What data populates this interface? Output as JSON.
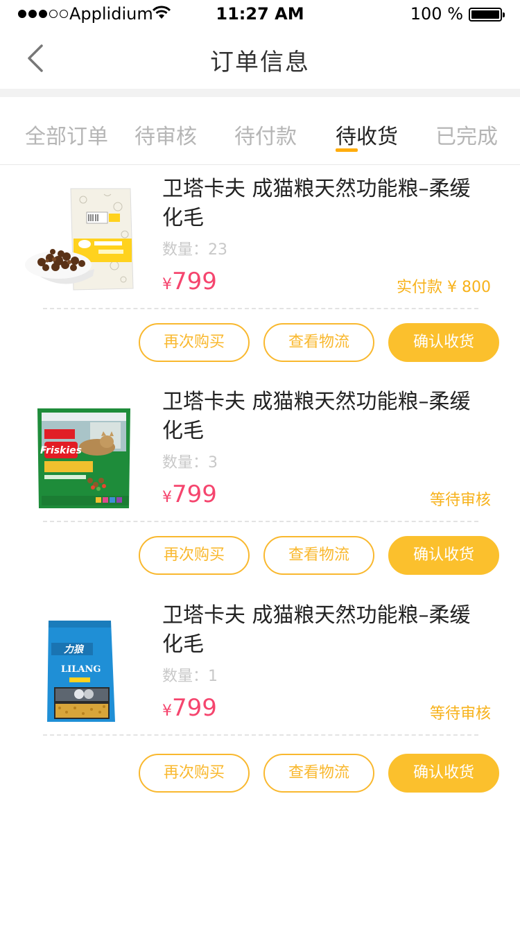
{
  "status_bar": {
    "carrier": "Applidium",
    "time": "11:27 AM",
    "battery": "100 %"
  },
  "nav": {
    "title": "订单信息",
    "back_icon": "chevron-left-icon"
  },
  "tabs": [
    {
      "label": "全部订单",
      "active": false
    },
    {
      "label": "待审核",
      "active": false
    },
    {
      "label": "待付款",
      "active": false
    },
    {
      "label": "待收货",
      "active": true
    },
    {
      "label": "已完成",
      "active": false
    }
  ],
  "orders": [
    {
      "title": "卫塔卡夫 成猫粮天然功能粮–柔缓化毛",
      "quantity": "数量：23",
      "price_symbol": "¥",
      "price": "799",
      "status": "实付款 ¥ 800",
      "buttons": [
        "再次购买",
        "查看物流",
        "确认收货"
      ]
    },
    {
      "title": "卫塔卡夫 成猫粮天然功能粮–柔缓化毛",
      "quantity": "数量：3",
      "price_symbol": "¥",
      "price": "799",
      "status": "等待审核",
      "buttons": [
        "再次购买",
        "查看物流",
        "确认收货"
      ]
    },
    {
      "title": "卫塔卡夫 成猫粮天然功能粮–柔缓化毛",
      "quantity": "数量：1",
      "price_symbol": "¥",
      "price": "799",
      "status": "等待审核",
      "buttons": [
        "再次购买",
        "查看物流",
        "确认收货"
      ]
    }
  ],
  "colors": {
    "accent": "#fbc02d",
    "price": "#f5456e",
    "status": "#f7b21b",
    "tab_underline": "#ffad0d"
  }
}
